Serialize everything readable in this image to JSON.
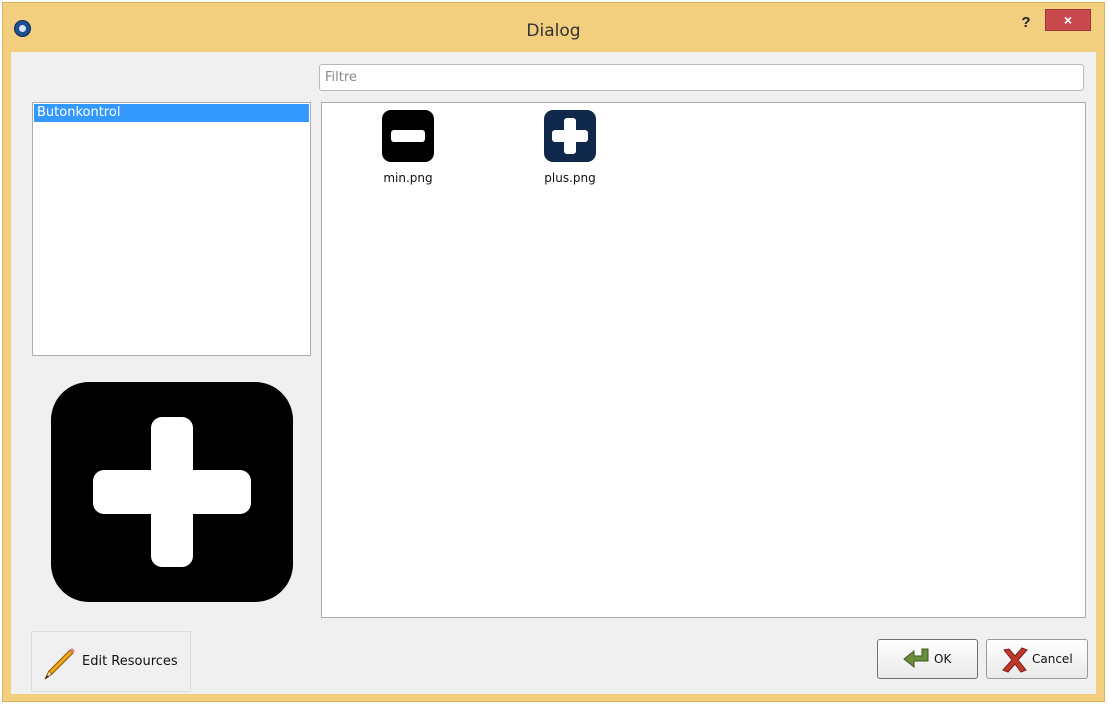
{
  "window": {
    "title": "Dialog",
    "help_label": "?",
    "close_label": "×"
  },
  "filter": {
    "placeholder": "Filtre",
    "value": ""
  },
  "prefixes": [
    {
      "label": "Butonkontrol",
      "selected": true
    }
  ],
  "files": [
    {
      "name": "min.png",
      "icon": "minus-square-icon",
      "color": "#000000"
    },
    {
      "name": "plus.png",
      "icon": "plus-square-icon",
      "color": "#10294a"
    }
  ],
  "preview": {
    "icon": "plus-square-icon",
    "color": "#000000"
  },
  "buttons": {
    "edit_resources": "Edit Resources",
    "ok": "OK",
    "cancel": "Cancel"
  },
  "colors": {
    "title_bar": "#f2cf7e",
    "selection": "#3399ff",
    "close": "#c9484b"
  }
}
